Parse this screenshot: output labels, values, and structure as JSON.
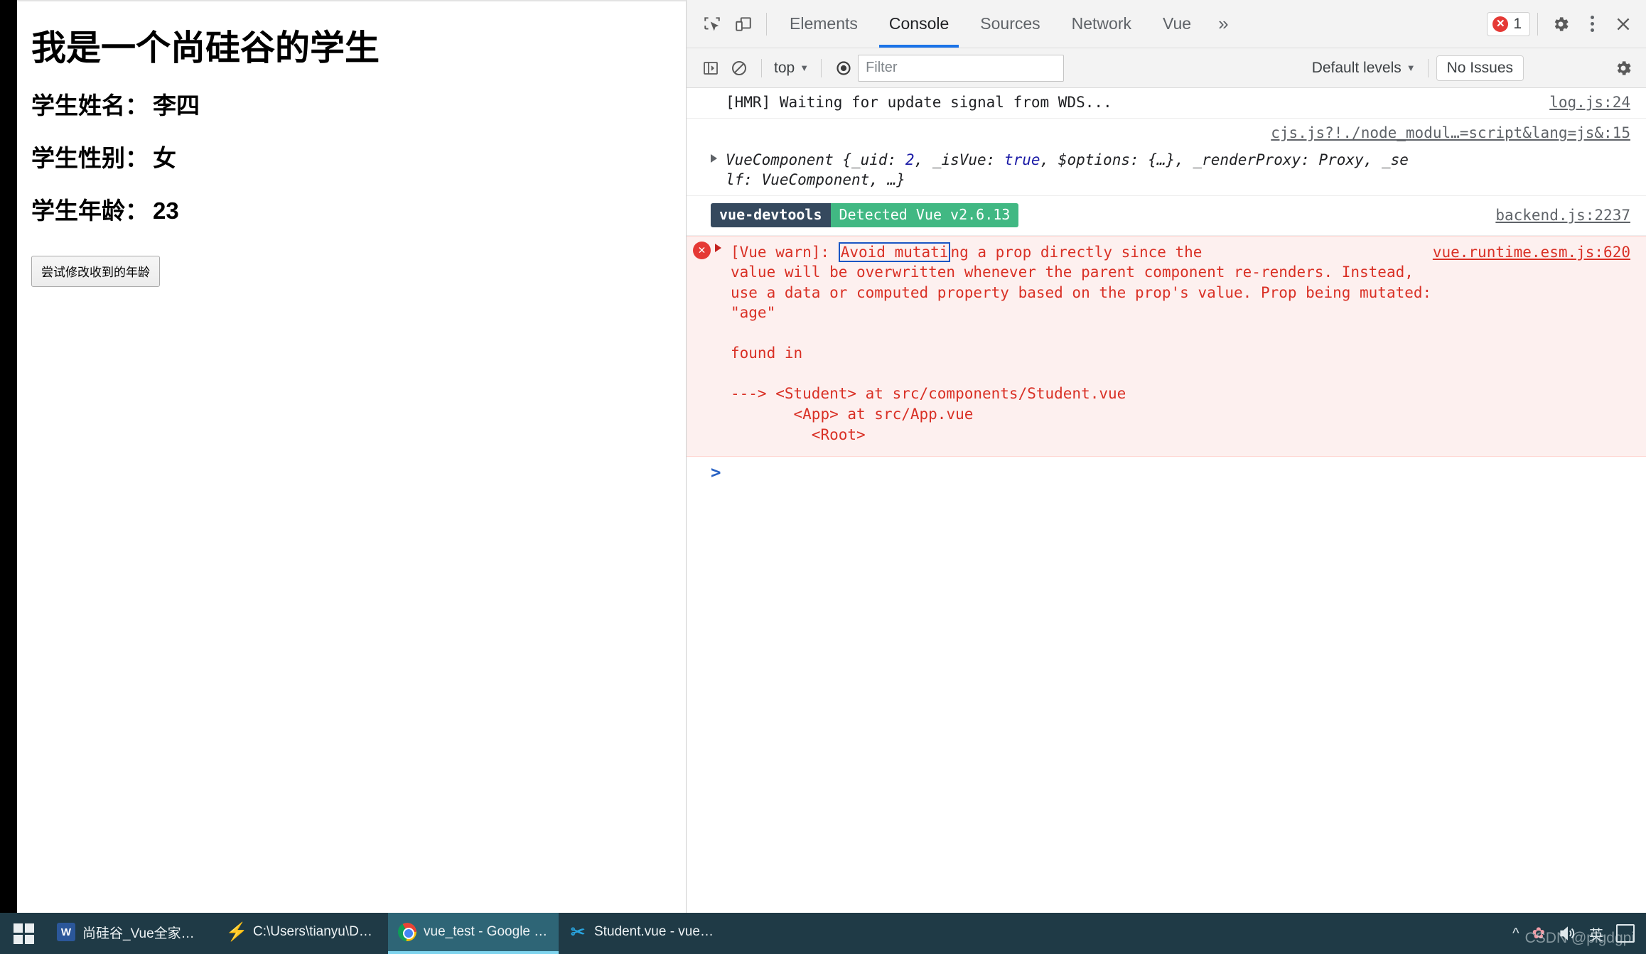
{
  "page": {
    "title": "我是一个尚硅谷的学生",
    "fields": [
      {
        "label": "学生姓名：",
        "value": "李四"
      },
      {
        "label": "学生性别：",
        "value": "女"
      },
      {
        "label": "学生年龄：",
        "value": "23"
      }
    ],
    "button_label": "尝试修改收到的年龄"
  },
  "devtools": {
    "tabs": [
      {
        "label": "Elements",
        "active": false
      },
      {
        "label": "Console",
        "active": true
      },
      {
        "label": "Sources",
        "active": false
      },
      {
        "label": "Network",
        "active": false
      },
      {
        "label": "Vue",
        "active": false
      }
    ],
    "more_label": "»",
    "error_count": "1",
    "icons": {
      "inspect": "inspect-element-icon",
      "device": "device-toolbar-icon",
      "settings": "gear-icon",
      "menu": "kebab-menu-icon",
      "close": "close-icon"
    },
    "console_toolbar": {
      "sidebar_toggle": "console-sidebar-icon",
      "clear": "clear-console-icon",
      "context": "top",
      "eye": "live-expression-icon",
      "filter_placeholder": "Filter",
      "filter_value": "",
      "levels": "Default levels",
      "issues": "No Issues",
      "settings": "gear-icon"
    },
    "messages": {
      "hmr": {
        "text": "[HMR] Waiting for update signal from WDS...",
        "source": "log.js:24"
      },
      "component": {
        "source": "cjs.js?!./node_modul…=script&lang=js&:15",
        "line1_a": "VueComponent {_uid: ",
        "uid": "2",
        "line1_b": ", _isVue: ",
        "isvue": "true",
        "line1_c": ", $options: {…}, _renderProxy: Proxy, _se",
        "line2": "lf: VueComponent, …}"
      },
      "devtools_badge": {
        "left": "vue-devtools",
        "right": "Detected Vue v2.6.13",
        "source": "backend.js:2237"
      },
      "warning": {
        "prefix": "[Vue warn]: ",
        "selected": "Avoid mutati",
        "rest_line1": "ng a prop directly since the ",
        "source": "vue.runtime.esm.js:620",
        "body": "value will be overwritten whenever the parent component re-renders. Instead,\nuse a data or computed property based on the prop's value. Prop being mutated:\n\"age\"\n\nfound in\n\n---> <Student> at src/components/Student.vue\n       <App> at src/App.vue\n         <Root>"
      }
    },
    "prompt": ">"
  },
  "taskbar": {
    "start": "windows-start-icon",
    "items": [
      {
        "icon": "word-icon",
        "label": "尚硅谷_Vue全家桶.d...",
        "active": false
      },
      {
        "icon": "sublime-icon",
        "label": "C:\\Users\\tianyu\\Des...",
        "active": false
      },
      {
        "icon": "chrome-icon",
        "label": "vue_test - Google C...",
        "active": true
      },
      {
        "icon": "vscode-icon",
        "label": "Student.vue - vue_t...",
        "active": false
      }
    ],
    "tray": {
      "chevron": "^",
      "flower": "✿",
      "volume": "volume-icon",
      "ime": "英"
    },
    "watermark": "CSDN @pigdgpi"
  },
  "colors": {
    "accent": "#1a73e8",
    "error": "#d93025",
    "vue_green": "#41b883",
    "vue_navy": "#35495e",
    "taskbar": "#1f3a46"
  }
}
